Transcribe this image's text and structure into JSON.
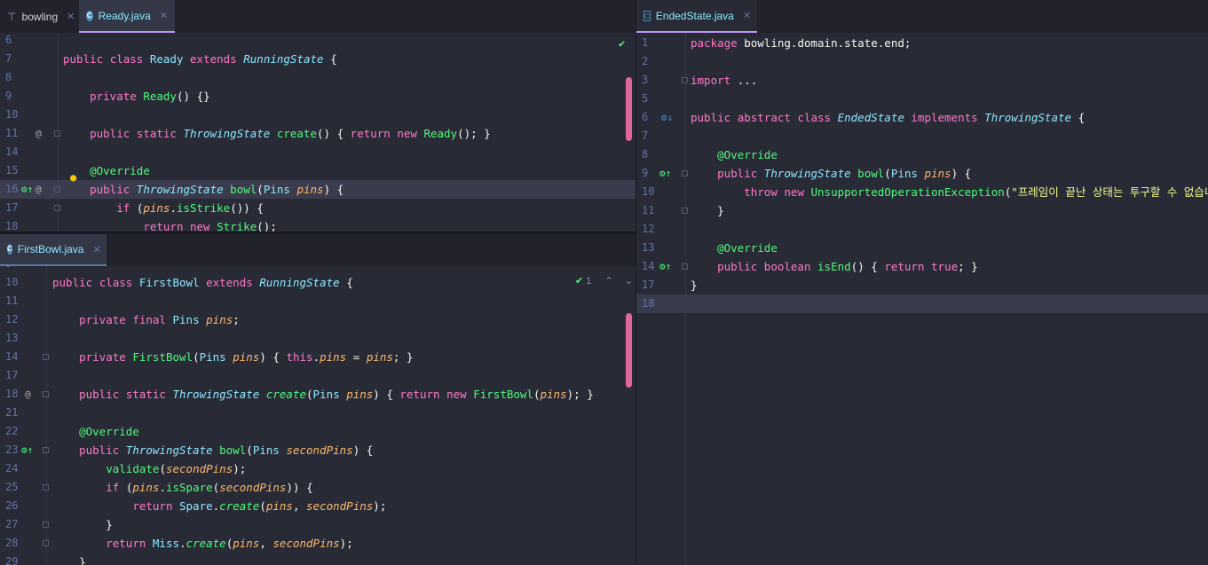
{
  "left_top_tabs": [
    {
      "label": "bowling",
      "kind": "project"
    },
    {
      "label": "Ready.java",
      "kind": "class",
      "active": true
    }
  ],
  "left_bottom_tabs": [
    {
      "label": "FirstBowl.java",
      "kind": "class",
      "active": true
    }
  ],
  "right_tabs": [
    {
      "label": "EndedState.java",
      "kind": "abstract",
      "active": true
    }
  ],
  "ready_lines": [
    {
      "n": "6",
      "t": ""
    },
    {
      "n": "7",
      "t": "public class Ready extends RunningState {"
    },
    {
      "n": "8",
      "t": ""
    },
    {
      "n": "9",
      "t": "    private Ready() {}"
    },
    {
      "n": "10",
      "t": ""
    },
    {
      "n": "11",
      "t": "    public static ThrowingState create() { return new Ready(); }"
    },
    {
      "n": "14",
      "t": ""
    },
    {
      "n": "15",
      "t": "    @Override"
    },
    {
      "n": "16",
      "t": "    public ThrowingState bowl(Pins pins) {"
    },
    {
      "n": "17",
      "t": "        if (pins.isStrike()) {"
    },
    {
      "n": "18",
      "t": "            return new Strike();"
    }
  ],
  "firstbowl_lines": [
    {
      "n": "9",
      "t": ""
    },
    {
      "n": "10",
      "t": "public class FirstBowl extends RunningState {"
    },
    {
      "n": "11",
      "t": ""
    },
    {
      "n": "12",
      "t": "    private final Pins pins;"
    },
    {
      "n": "13",
      "t": ""
    },
    {
      "n": "14",
      "t": "    private FirstBowl(Pins pins) { this.pins = pins; }"
    },
    {
      "n": "17",
      "t": ""
    },
    {
      "n": "18",
      "t": "    public static ThrowingState create(Pins pins) { return new FirstBowl(pins); }"
    },
    {
      "n": "21",
      "t": ""
    },
    {
      "n": "22",
      "t": "    @Override"
    },
    {
      "n": "23",
      "t": "    public ThrowingState bowl(Pins secondPins) {"
    },
    {
      "n": "24",
      "t": "        validate(secondPins);"
    },
    {
      "n": "25",
      "t": "        if (pins.isSpare(secondPins)) {"
    },
    {
      "n": "26",
      "t": "            return Spare.create(pins, secondPins);"
    },
    {
      "n": "27",
      "t": "        }"
    },
    {
      "n": "28",
      "t": "        return Miss.create(pins, secondPins);"
    },
    {
      "n": "29",
      "t": "    }"
    }
  ],
  "ended_lines": [
    {
      "n": "1",
      "t": "package bowling.domain.state.end;"
    },
    {
      "n": "2",
      "t": ""
    },
    {
      "n": "3",
      "t": "import ..."
    },
    {
      "n": "5",
      "t": ""
    },
    {
      "n": "6",
      "t": "public abstract class EndedState implements ThrowingState {"
    },
    {
      "n": "7",
      "t": ""
    },
    {
      "n": "8",
      "t": "    @Override"
    },
    {
      "n": "9",
      "t": "    public ThrowingState bowl(Pins pins) {"
    },
    {
      "n": "10",
      "t": "        throw new UnsupportedOperationException(\"프레임이 끝난 상태는 투구할 수 없습니다.\");"
    },
    {
      "n": "11",
      "t": "    }"
    },
    {
      "n": "12",
      "t": ""
    },
    {
      "n": "13",
      "t": "    @Override"
    },
    {
      "n": "14",
      "t": "    public boolean isEnd() { return true; }"
    },
    {
      "n": "17",
      "t": "}"
    },
    {
      "n": "18",
      "t": ""
    }
  ],
  "inspection_count": "1",
  "colors": {
    "keyword": "#ff79c6",
    "type": "#8be9fd",
    "method": "#50fa7b",
    "param": "#ffb86c",
    "string": "#f1fa8c",
    "scroll_marker": "#e0669b"
  }
}
